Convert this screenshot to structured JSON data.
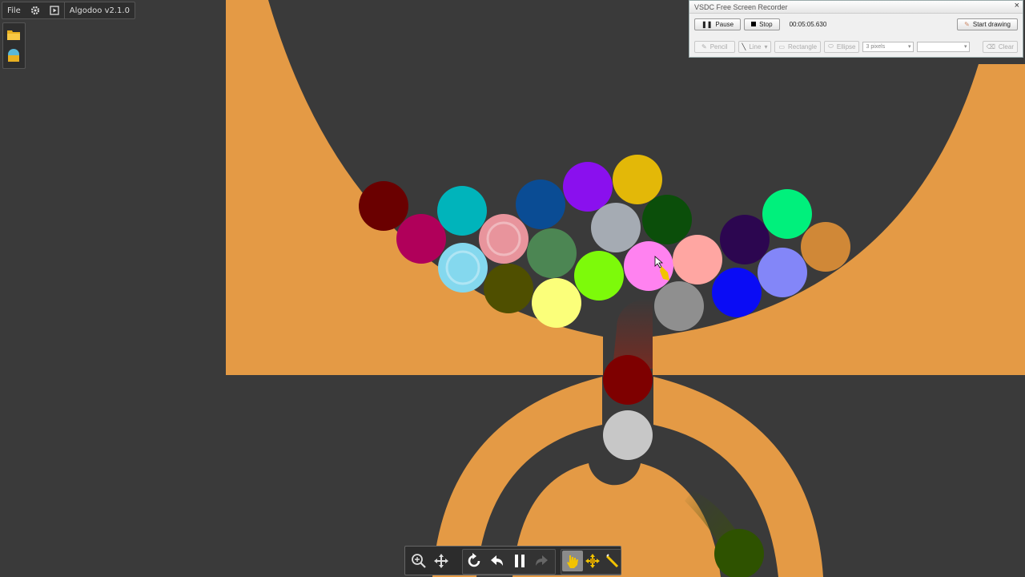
{
  "app": {
    "menu": {
      "file_label": "File",
      "title": "Algodoo v2.1.0"
    },
    "sidebar": [
      "folder-icon",
      "scene-icon"
    ],
    "toolbar": [
      "zoom-icon",
      "pan-icon",
      "reset-icon",
      "undo-icon",
      "pause-icon",
      "redo-icon",
      "drag-tool-icon",
      "move-tool-icon",
      "sketch-tool-icon"
    ]
  },
  "recorder": {
    "title": "VSDC Free Screen Recorder",
    "close": "×",
    "pause_label": "Pause",
    "stop_label": "Stop",
    "timer": "00:05:05.630",
    "start_drawing_label": "Start drawing",
    "pencil_label": "Pencil",
    "line_label": "Line",
    "rectangle_label": "Rectangle",
    "ellipse_label": "Ellipse",
    "thickness_value": "3 pixels",
    "clear_label": "Clear"
  },
  "colors": {
    "background": "#3a3a3a",
    "orange": "#e49a45",
    "ball_colors": [
      "#6a0000",
      "#b0005a",
      "#00b4bb",
      "#e8949c",
      "#0a4c94",
      "#8a10ee",
      "#e3b808",
      "#a5abb3",
      "#0b4e0a",
      "#84d8ee",
      "#4f4f00",
      "#4c8653",
      "#7dfa0a",
      "#ff82f0",
      "#ffa6a2",
      "#fbff7a",
      "#8f8f8f",
      "#2c0650",
      "#00f07c",
      "#0a0cf5",
      "#8386f8",
      "#d08837",
      "#7e0000",
      "#c7c7c7",
      "#2e5200"
    ]
  }
}
